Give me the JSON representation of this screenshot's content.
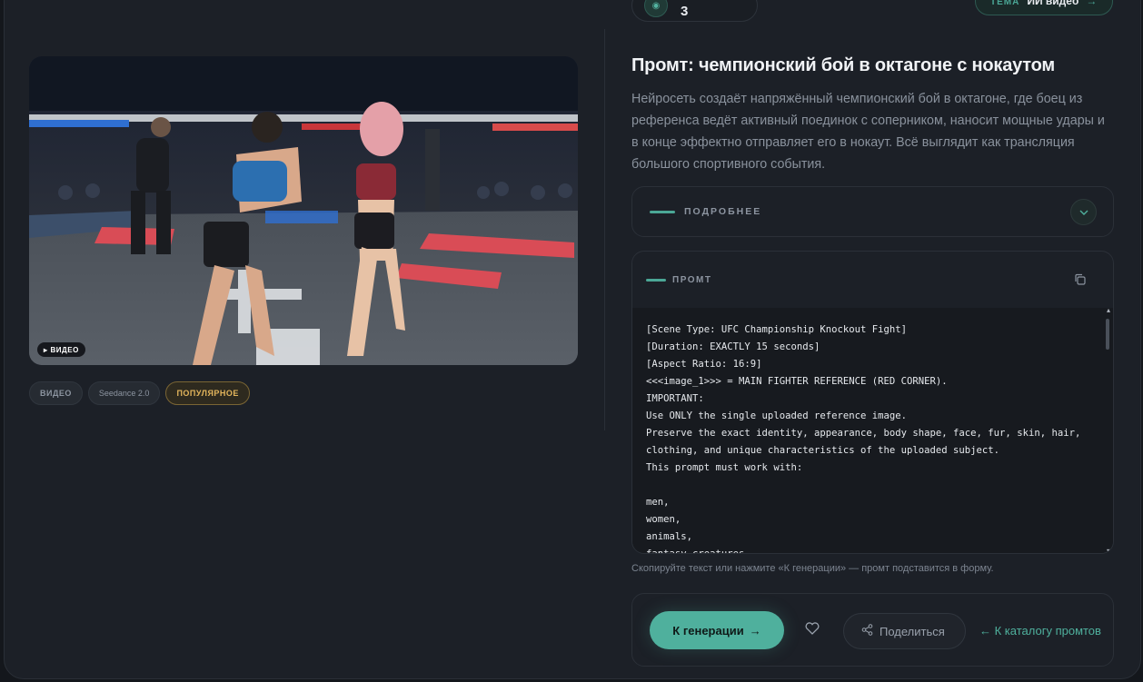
{
  "top": {
    "count": "3",
    "right_pill_key": "ТЕМА",
    "right_pill_value": "ИИ видео",
    "right_pill_arrow": "→"
  },
  "media": {
    "badge": "ВИДЕО",
    "badge_icon": "play-icon"
  },
  "tags": [
    "ВИДЕО",
    "Seedance 2.0",
    "ПОПУЛЯРНОЕ"
  ],
  "title": "Промт: чемпионский бой в октагоне с нокаутом",
  "description": "Нейросеть создаёт напряжённый чемпионский бой в октагоне, где боец из референса ведёт активный поединок с соперником, наносит мощные удары и в конце эффектно отправляет его в нокаут. Всё выглядит как трансляция большого спортивного события.",
  "details": {
    "label": "ПОДРОБНЕЕ",
    "icon": "chevron-down-icon"
  },
  "prompt": {
    "label": "ПРОМТ",
    "copy_icon": "copy-icon",
    "text": "[Scene Type: UFC Championship Knockout Fight]\n[Duration: EXACTLY 15 seconds]\n[Aspect Ratio: 16:9]\n<<<image_1>>> = MAIN FIGHTER REFERENCE (RED CORNER).\nIMPORTANT:\nUse ONLY the single uploaded reference image.\nPreserve the exact identity, appearance, body shape, face, fur, skin, hair,\nclothing, and unique characteristics of the uploaded subject.\nThis prompt must work with:\n\nmen,\nwomen,\nanimals,\nfantasy creatures,"
  },
  "hint": "Скопируйте текст или нажмите «К генерации» — промт подставится в форму.",
  "actions": {
    "generate": "К генерации",
    "generate_arrow": "→",
    "share": "Поделиться",
    "catalog": "← К каталогу промтов"
  },
  "colors": {
    "accent": "#4fb09d",
    "background": "#1c2027",
    "gold": "#e3b55c"
  }
}
